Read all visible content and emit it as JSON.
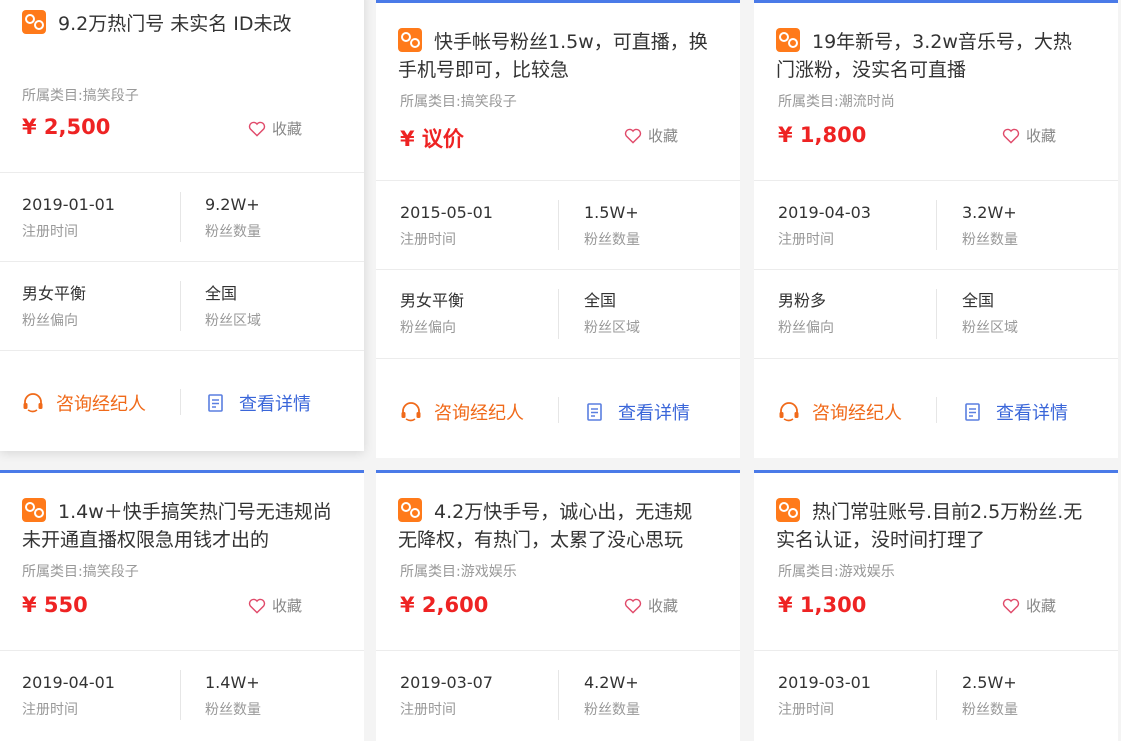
{
  "cards": [
    {
      "title": "9.2万热门号 未实名 ID未改",
      "category": "所属类目:搞笑段子",
      "price": "¥ 2,500",
      "fav": "收藏",
      "reg_date": "2019-01-01",
      "reg_label": "注册时间",
      "fans": "9.2W+",
      "fans_label": "粉丝数量",
      "gender": "男女平衡",
      "gender_label": "粉丝偏向",
      "region": "全国",
      "region_label": "粉丝区域",
      "consult": "咨询经纪人",
      "detail": "查看详情"
    },
    {
      "title": "快手帐号粉丝1.5w，可直播，换手机号即可，比较急",
      "category": "所属类目:搞笑段子",
      "price": "¥ 议价",
      "fav": "收藏",
      "reg_date": "2015-05-01",
      "reg_label": "注册时间",
      "fans": "1.5W+",
      "fans_label": "粉丝数量",
      "gender": "男女平衡",
      "gender_label": "粉丝偏向",
      "region": "全国",
      "region_label": "粉丝区域",
      "consult": "咨询经纪人",
      "detail": "查看详情"
    },
    {
      "title": "19年新号，3.2w音乐号，大热门涨粉，没实名可直播",
      "category": "所属类目:潮流时尚",
      "price": "¥ 1,800",
      "fav": "收藏",
      "reg_date": "2019-04-03",
      "reg_label": "注册时间",
      "fans": "3.2W+",
      "fans_label": "粉丝数量",
      "gender": "男粉多",
      "gender_label": "粉丝偏向",
      "region": "全国",
      "region_label": "粉丝区域",
      "consult": "咨询经纪人",
      "detail": "查看详情"
    },
    {
      "title": "1.4w＋快手搞笑热门号无违规尚未开通直播权限急用钱才出的",
      "category": "所属类目:搞笑段子",
      "price": "¥ 550",
      "fav": "收藏",
      "reg_date": "2019-04-01",
      "reg_label": "注册时间",
      "fans": "1.4W+",
      "fans_label": "粉丝数量"
    },
    {
      "title": "4.2万快手号，诚心出，无违规无降权，有热门，太累了没心思玩",
      "category": "所属类目:游戏娱乐",
      "price": "¥ 2,600",
      "fav": "收藏",
      "reg_date": "2019-03-07",
      "reg_label": "注册时间",
      "fans": "4.2W+",
      "fans_label": "粉丝数量"
    },
    {
      "title": "热门常驻账号.目前2.5万粉丝.无实名认证，没时间打理了",
      "category": "所属类目:游戏娱乐",
      "price": "¥ 1,300",
      "fav": "收藏",
      "reg_date": "2019-03-01",
      "reg_label": "注册时间",
      "fans": "2.5W+",
      "fans_label": "粉丝数量"
    }
  ],
  "colors": {
    "price": "#ee2323",
    "consult": "#f06a1a",
    "detail": "#3a66d9",
    "accent": "#4a7ae8",
    "logo": "#ff7a1a"
  }
}
